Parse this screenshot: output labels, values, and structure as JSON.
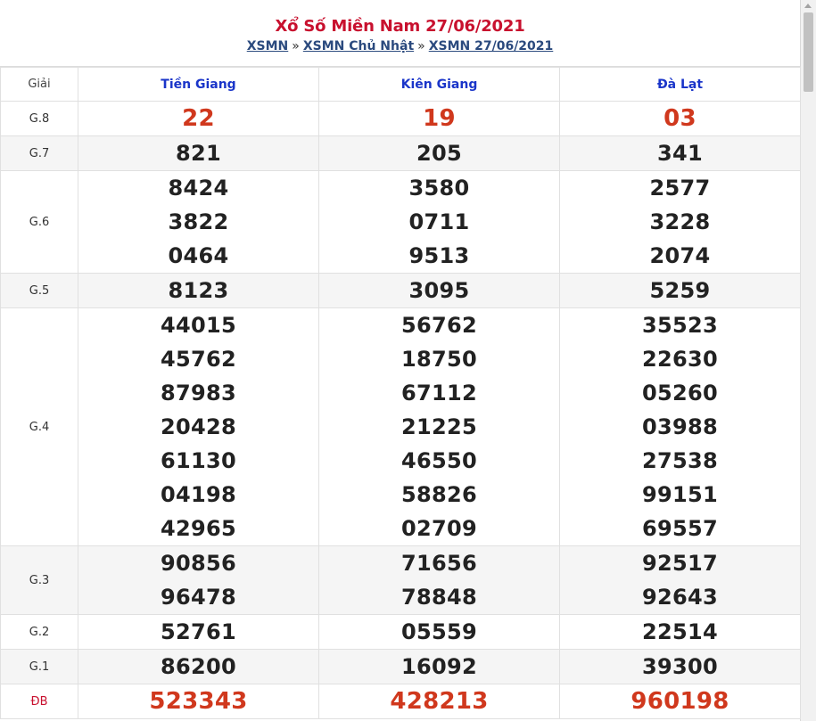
{
  "header": {
    "title": "Xổ Số Miền Nam 27/06/2021",
    "breadcrumb": {
      "items": [
        "XSMN",
        "XSMN Chủ Nhật",
        "XSMN 27/06/2021"
      ],
      "separator": "»"
    }
  },
  "table": {
    "label_header": "Giải",
    "provinces": [
      "Tiền Giang",
      "Kiên Giang",
      "Đà Lạt"
    ],
    "prizes": {
      "g8": {
        "label": "G.8",
        "values": [
          "22",
          "19",
          "03"
        ]
      },
      "g7": {
        "label": "G.7",
        "values": [
          "821",
          "205",
          "341"
        ]
      },
      "g6": {
        "label": "G.6",
        "values": [
          [
            "8424",
            "3822",
            "0464"
          ],
          [
            "3580",
            "0711",
            "9513"
          ],
          [
            "2577",
            "3228",
            "2074"
          ]
        ]
      },
      "g5": {
        "label": "G.5",
        "values": [
          "8123",
          "3095",
          "5259"
        ]
      },
      "g4": {
        "label": "G.4",
        "values": [
          [
            "44015",
            "45762",
            "87983",
            "20428",
            "61130",
            "04198",
            "42965"
          ],
          [
            "56762",
            "18750",
            "67112",
            "21225",
            "46550",
            "58826",
            "02709"
          ],
          [
            "35523",
            "22630",
            "05260",
            "03988",
            "27538",
            "99151",
            "69557"
          ]
        ]
      },
      "g3": {
        "label": "G.3",
        "values": [
          [
            "90856",
            "96478"
          ],
          [
            "71656",
            "78848"
          ],
          [
            "92517",
            "92643"
          ]
        ]
      },
      "g2": {
        "label": "G.2",
        "values": [
          "52761",
          "05559",
          "22514"
        ]
      },
      "g1": {
        "label": "G.1",
        "values": [
          "86200",
          "16092",
          "39300"
        ]
      },
      "db": {
        "label": "ĐB",
        "values": [
          "523343",
          "428213",
          "960198"
        ]
      }
    }
  },
  "colors": {
    "title_red": "#c8102e",
    "special_number_red": "#d0381d",
    "province_blue": "#1a35c9",
    "link_blue": "#2b4a7e",
    "row_shade": "#f5f5f5"
  }
}
